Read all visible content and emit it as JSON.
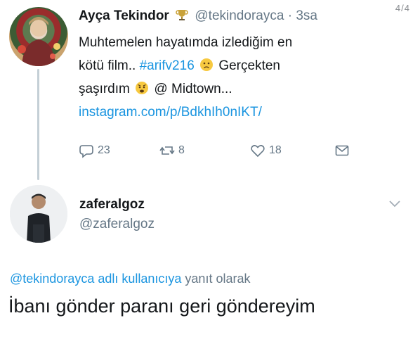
{
  "page_counter": "4/4",
  "original_tweet": {
    "display_name": "Ayça Tekindor",
    "handle": "@tekindorayca",
    "dot": "·",
    "time": "3sa",
    "text_line1": "Muhtemelen hayatımda izlediğim en",
    "text_line2_prefix": "kötü film..",
    "hashtag": "#arifv216",
    "text_line2_suffix": "Gerçekten",
    "text_line3": "şaşırdım",
    "text_line3_suffix": "@ Midtown...",
    "link": "instagram.com/p/BdkhIh0nIKT/",
    "reply_count": "23",
    "retweet_count": "8",
    "like_count": "18",
    "icons": {
      "trophy": "trophy-icon",
      "emoji_1": "slightly-frowning-face-icon",
      "emoji_2": "anxious-face-icon",
      "reply": "reply-icon",
      "retweet": "retweet-icon",
      "like": "heart-icon",
      "dm": "envelope-icon"
    }
  },
  "reply": {
    "user_name": "zaferalgoz",
    "user_handle": "@zaferalgoz",
    "context_mention": "@tekindorayca adlı kullanıcıya",
    "context_suffix": "yanıt olarak",
    "text": "İbanı gönder paranı geri göndereyim",
    "icons": {
      "menu": "chevron-down-icon"
    }
  },
  "colors": {
    "link": "#1b95e0",
    "muted": "#657786",
    "text": "#14171a",
    "thread_line": "#c4cfd6"
  }
}
